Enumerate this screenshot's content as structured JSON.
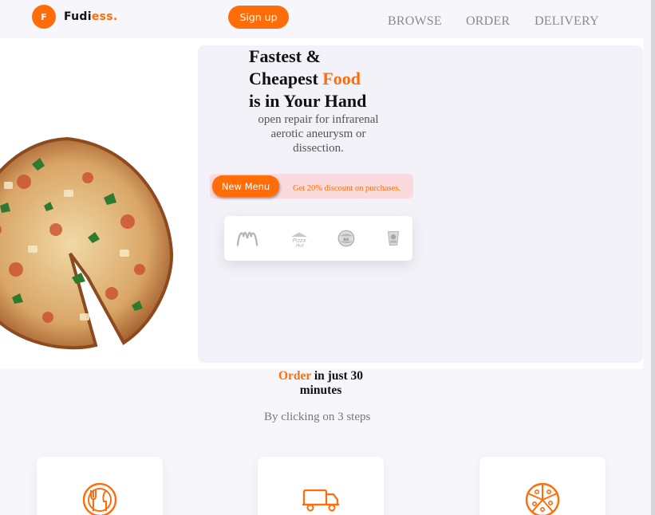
{
  "brand": {
    "badge_letter": "F",
    "name_main": "Fudi",
    "name_accent": "ess",
    "name_dot": "."
  },
  "nav": {
    "signup_label": "Sign up",
    "items": [
      "BROWSE",
      "ORDER",
      "DELIVERY"
    ]
  },
  "hero": {
    "headline_line1": "Fastest &",
    "headline_line2_plain": "Cheapest ",
    "headline_line2_accent": "Food",
    "headline_line3": "is in Your Hand",
    "subtitle": "open repair for infrarenal aerotic aneurysm or dissection.",
    "new_menu_label": "New Menu",
    "discount_text": "Get 20% discount on purchases.",
    "partner_logos": [
      "mcdonalds-logo",
      "pizza-hut-logo",
      "burger-king-logo",
      "kfc-logo"
    ]
  },
  "order": {
    "title_accent": "Order",
    "title_rest": " in just 30 minutes",
    "subtitle": "By clicking on 3 steps",
    "steps": [
      {
        "icon": "dining-icon"
      },
      {
        "icon": "delivery-truck-icon"
      },
      {
        "icon": "pizza-icon"
      }
    ]
  },
  "colors": {
    "accent": "#ff6d0a",
    "promo_bg": "#fadadd",
    "card_bg": "#f2f2f8"
  }
}
